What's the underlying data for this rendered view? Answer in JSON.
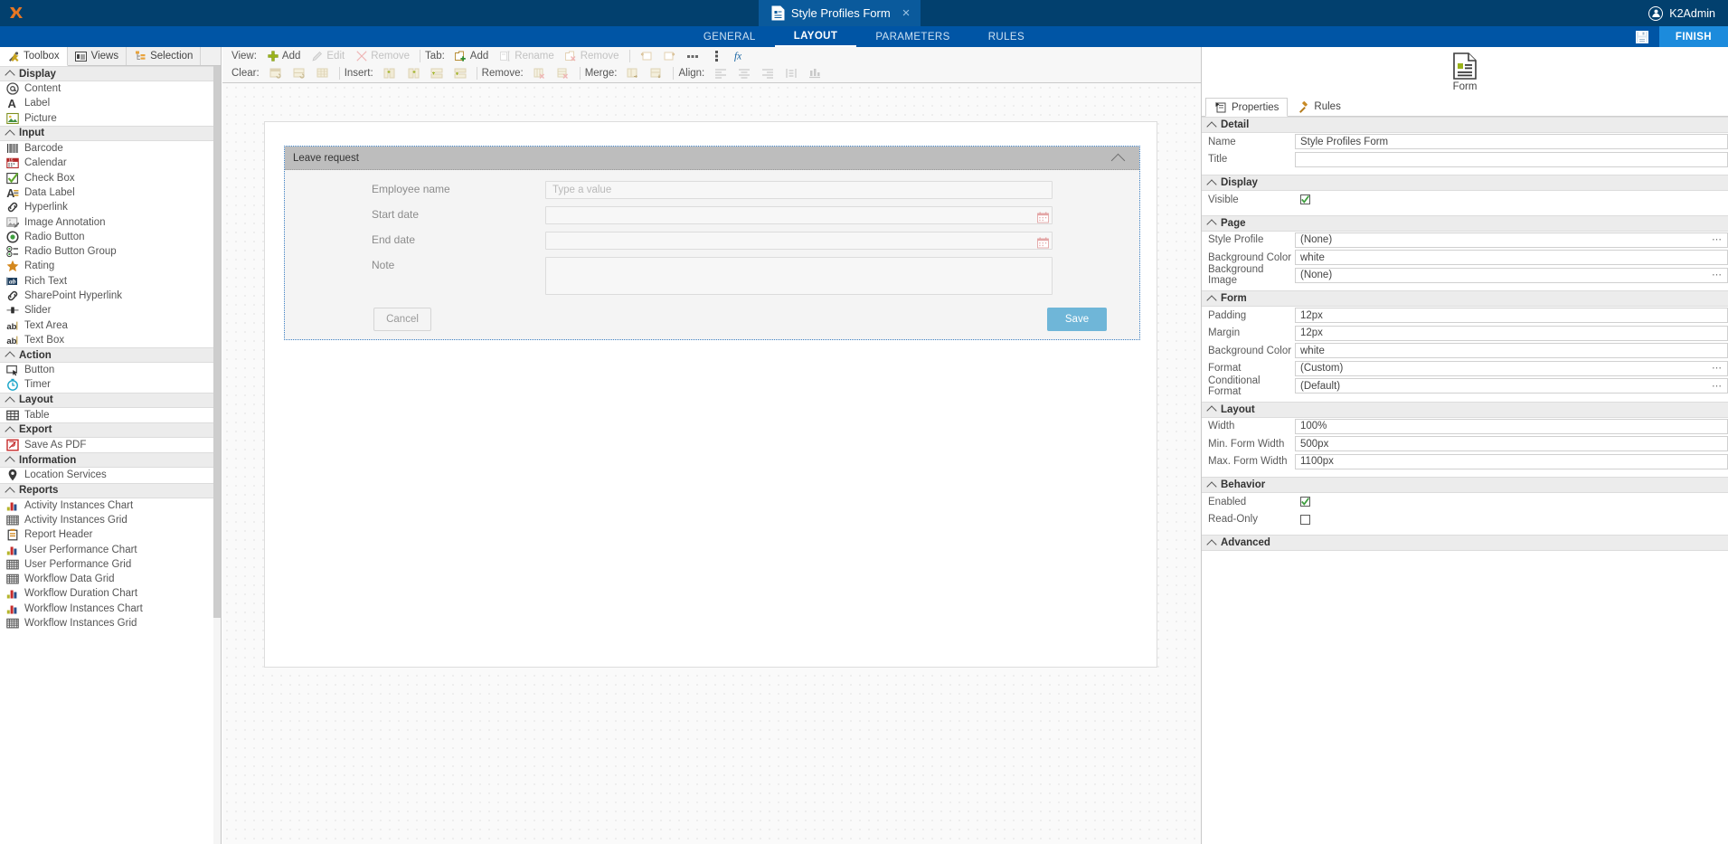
{
  "titlebar": {
    "logo": "k2-logo-icon",
    "document_tab": {
      "title": "Style Profiles Form",
      "close": "×",
      "icon": "form-document-icon"
    },
    "user": {
      "name": "K2Admin",
      "icon": "user-avatar-icon"
    }
  },
  "ribbon": {
    "tabs": [
      {
        "label": "GENERAL",
        "active": false
      },
      {
        "label": "LAYOUT",
        "active": true
      },
      {
        "label": "PARAMETERS",
        "active": false
      },
      {
        "label": "RULES",
        "active": false
      }
    ],
    "save_icon": "save-disk-icon",
    "finish_label": "FINISH"
  },
  "left_panel": {
    "tabs": [
      {
        "label": "Toolbox",
        "icon": "tools-icon",
        "active": true
      },
      {
        "label": "Views",
        "icon": "views-icon",
        "active": false
      },
      {
        "label": "Selection",
        "icon": "selection-tree-icon",
        "active": false
      }
    ],
    "groups": [
      {
        "title": "Display",
        "items": [
          {
            "label": "Content",
            "icon": "at-sign-icon"
          },
          {
            "label": "Label",
            "icon": "letter-a-icon"
          },
          {
            "label": "Picture",
            "icon": "picture-icon"
          }
        ]
      },
      {
        "title": "Input",
        "items": [
          {
            "label": "Barcode",
            "icon": "barcode-icon"
          },
          {
            "label": "Calendar",
            "icon": "calendar-icon"
          },
          {
            "label": "Check Box",
            "icon": "checkbox-icon"
          },
          {
            "label": "Data Label",
            "icon": "data-label-icon"
          },
          {
            "label": "Hyperlink",
            "icon": "link-icon"
          },
          {
            "label": "Image Annotation",
            "icon": "image-annotation-icon"
          },
          {
            "label": "Radio Button",
            "icon": "radio-button-icon"
          },
          {
            "label": "Radio Button Group",
            "icon": "radio-group-icon"
          },
          {
            "label": "Rating",
            "icon": "star-icon"
          },
          {
            "label": "Rich Text",
            "icon": "rich-text-icon"
          },
          {
            "label": "SharePoint Hyperlink",
            "icon": "link-icon"
          },
          {
            "label": "Slider",
            "icon": "slider-icon"
          },
          {
            "label": "Text Area",
            "icon": "text-area-icon"
          },
          {
            "label": "Text Box",
            "icon": "text-box-icon"
          }
        ]
      },
      {
        "title": "Action",
        "items": [
          {
            "label": "Button",
            "icon": "button-icon"
          },
          {
            "label": "Timer",
            "icon": "timer-icon"
          }
        ]
      },
      {
        "title": "Layout",
        "items": [
          {
            "label": "Table",
            "icon": "table-icon"
          }
        ]
      },
      {
        "title": "Export",
        "items": [
          {
            "label": "Save As PDF",
            "icon": "pdf-icon"
          }
        ]
      },
      {
        "title": "Information",
        "items": [
          {
            "label": "Location Services",
            "icon": "map-pin-icon"
          }
        ]
      },
      {
        "title": "Reports",
        "items": [
          {
            "label": "Activity Instances Chart",
            "icon": "bar-chart-icon"
          },
          {
            "label": "Activity Instances Grid",
            "icon": "grid-icon"
          },
          {
            "label": "Report Header",
            "icon": "report-header-icon"
          },
          {
            "label": "User Performance Chart",
            "icon": "bar-chart-icon"
          },
          {
            "label": "User Performance Grid",
            "icon": "grid-icon"
          },
          {
            "label": "Workflow Data Grid",
            "icon": "grid-icon"
          },
          {
            "label": "Workflow Duration Chart",
            "icon": "bar-chart-icon"
          },
          {
            "label": "Workflow Instances Chart",
            "icon": "bar-chart-icon"
          },
          {
            "label": "Workflow Instances Grid",
            "icon": "grid-icon"
          }
        ]
      }
    ]
  },
  "toolbar": {
    "row1": {
      "view_label": "View:",
      "view_buttons": [
        {
          "label": "Add",
          "icon": "plus-green-icon",
          "disabled": false
        },
        {
          "label": "Edit",
          "icon": "pencil-icon",
          "disabled": true
        },
        {
          "label": "Remove",
          "icon": "x-red-icon",
          "disabled": true
        }
      ],
      "tab_label": "Tab:",
      "tab_buttons": [
        {
          "label": "Add",
          "icon": "tab-add-icon",
          "disabled": false
        },
        {
          "label": "Rename",
          "icon": "tab-rename-icon",
          "disabled": true
        },
        {
          "label": "Remove",
          "icon": "tab-remove-icon",
          "disabled": true
        }
      ],
      "extra_icons": [
        "tab-move-left-icon",
        "tab-move-right-icon",
        "more-dots-icon",
        "kebab-menu-icon",
        "function-fx-icon"
      ]
    },
    "row2": {
      "clear_label": "Clear:",
      "clear_icons": [
        "clear-cell-icon",
        "clear-row-icon",
        "clear-table-icon"
      ],
      "insert_label": "Insert:",
      "insert_icons": [
        "insert-column-left-icon",
        "insert-column-right-icon",
        "insert-row-above-icon",
        "insert-row-below-icon"
      ],
      "remove_label": "Remove:",
      "remove_icons": [
        "remove-column-icon",
        "remove-row-icon"
      ],
      "merge_label": "Merge:",
      "merge_icons": [
        "merge-right-icon",
        "merge-down-icon"
      ],
      "align_label": "Align:",
      "align_icons": [
        "align-left-icon",
        "align-center-icon",
        "align-right-icon",
        "align-distribute-icon",
        "align-bottom-icon"
      ]
    }
  },
  "canvas": {
    "form": {
      "title": "Leave request",
      "collapse_icon": "chevron-up-icon",
      "fields": [
        {
          "label": "Employee name",
          "type": "text",
          "placeholder": "Type a value",
          "value": ""
        },
        {
          "label": "Start date",
          "type": "date",
          "placeholder": "",
          "value": "",
          "icon": "calendar-icon"
        },
        {
          "label": "End date",
          "type": "date",
          "placeholder": "",
          "value": "",
          "icon": "calendar-icon"
        },
        {
          "label": "Note",
          "type": "textarea",
          "placeholder": "",
          "value": ""
        }
      ],
      "buttons": {
        "cancel": "Cancel",
        "save": "Save"
      }
    }
  },
  "right_panel": {
    "header": {
      "label": "Form",
      "icon": "form-document-icon"
    },
    "tabs": [
      {
        "label": "Properties",
        "icon": "properties-clipboard-icon",
        "active": true
      },
      {
        "label": "Rules",
        "icon": "rules-gavel-icon",
        "active": false
      }
    ],
    "sections": [
      {
        "title": "Detail",
        "rows": [
          {
            "key": "Name",
            "value": "Style Profiles Form",
            "kind": "text"
          },
          {
            "key": "Title",
            "value": "",
            "kind": "text"
          }
        ]
      },
      {
        "title": "Display",
        "rows": [
          {
            "key": "Visible",
            "value": "",
            "kind": "checkbox",
            "checked": true
          }
        ]
      },
      {
        "title": "Page",
        "rows": [
          {
            "key": "Style Profile",
            "value": "(None)",
            "kind": "picker"
          },
          {
            "key": "Background Color",
            "value": "white",
            "kind": "text"
          },
          {
            "key": "Background Image",
            "value": "(None)",
            "kind": "picker"
          }
        ]
      },
      {
        "title": "Form",
        "rows": [
          {
            "key": "Padding",
            "value": "12px",
            "kind": "text"
          },
          {
            "key": "Margin",
            "value": "12px",
            "kind": "text"
          },
          {
            "key": "Background Color",
            "value": "white",
            "kind": "text"
          },
          {
            "key": "Format",
            "value": "(Custom)",
            "kind": "picker"
          },
          {
            "key": "Conditional Format",
            "value": "(Default)",
            "kind": "picker"
          }
        ]
      },
      {
        "title": "Layout",
        "rows": [
          {
            "key": "Width",
            "value": "100%",
            "kind": "text"
          },
          {
            "key": "Min. Form Width",
            "value": "500px",
            "kind": "text"
          },
          {
            "key": "Max. Form Width",
            "value": "1100px",
            "kind": "text"
          }
        ]
      },
      {
        "title": "Behavior",
        "rows": [
          {
            "key": "Enabled",
            "value": "",
            "kind": "checkbox",
            "checked": true
          },
          {
            "key": "Read-Only",
            "value": "",
            "kind": "checkbox",
            "checked": false
          }
        ]
      },
      {
        "title": "Advanced",
        "rows": []
      }
    ]
  },
  "colors": {
    "titlebar": "#02406e",
    "ribbon": "#0055a5",
    "doc_tab": "#0a5a9c",
    "finish": "#1c8bdc",
    "accent_orange": "#e87722",
    "save_button": "#6fb6d8",
    "form_header": "#bdbdbd"
  }
}
